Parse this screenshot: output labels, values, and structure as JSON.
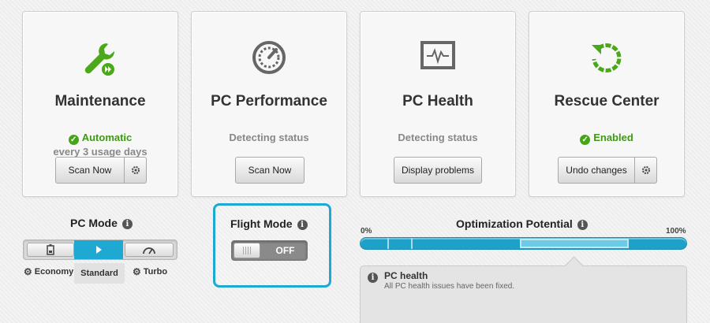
{
  "colors": {
    "accent": "#1ea9d3",
    "ok_green": "#45a517"
  },
  "cards": [
    {
      "title": "Maintenance",
      "status": "Automatic",
      "status_sub": "every 3 usage days",
      "button": "Scan Now",
      "icon": "wrench-icon"
    },
    {
      "title": "PC Performance",
      "status": "Detecting status",
      "button": "Scan Now",
      "icon": "speedometer-icon"
    },
    {
      "title": "PC Health",
      "status": "Detecting status",
      "button": "Display problems",
      "icon": "monitor-pulse-icon"
    },
    {
      "title": "Rescue Center",
      "status": "Enabled",
      "button": "Undo changes",
      "icon": "restore-icon"
    }
  ],
  "pc_mode": {
    "title": "PC Mode",
    "options": [
      "Economy",
      "Standard",
      "Turbo"
    ],
    "selected": "Standard"
  },
  "flight_mode": {
    "title": "Flight Mode",
    "state": "OFF"
  },
  "optimization": {
    "title": "Optimization Potential",
    "min_label": "0%",
    "max_label": "100%",
    "detail_title": "PC health",
    "detail_text": "All PC health issues have been fixed."
  },
  "info_glyph": "i",
  "check_glyph": "✓"
}
